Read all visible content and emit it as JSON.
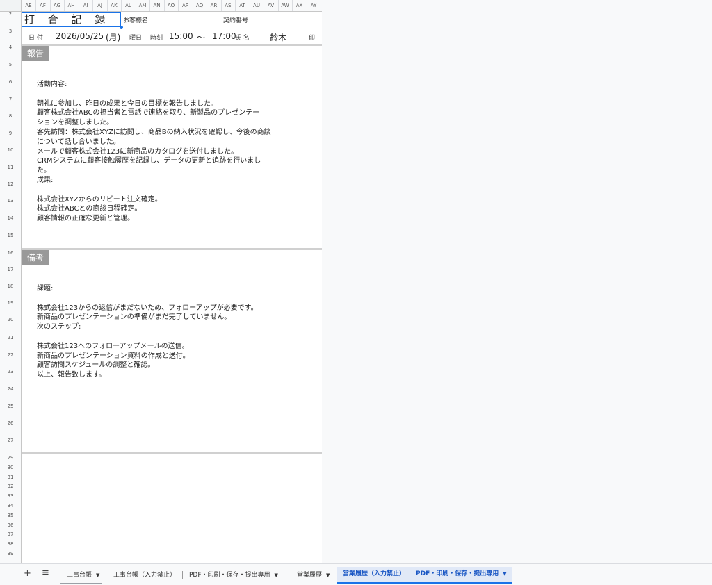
{
  "columns": [
    "AE",
    "AF",
    "AG",
    "AH",
    "AI",
    "AJ",
    "AK",
    "AL",
    "AM",
    "AN",
    "AO",
    "AP",
    "AQ",
    "AR",
    "AS",
    "AT",
    "AU",
    "AV",
    "AW",
    "AX",
    "AY"
  ],
  "rows_top": [
    "2",
    "3",
    "4",
    "5",
    "6",
    "7",
    "8",
    "9",
    "10",
    "11",
    "12",
    "13",
    "14",
    "15",
    "16",
    "17",
    "18",
    "19",
    "20",
    "21",
    "22",
    "23",
    "24",
    "25",
    "26",
    "27"
  ],
  "rows_bottom": [
    "29",
    "30",
    "31",
    "32",
    "33",
    "34",
    "35",
    "36",
    "37",
    "38",
    "39"
  ],
  "header": {
    "title": "打 合 記 録",
    "customer_label": "お客様名",
    "contract_label": "契約番号",
    "date_label": "日 付",
    "date_value": "2026/05/25",
    "weekday_value": "(月)",
    "weekday_label": "曜日",
    "time_label": "時刻",
    "time_start": "15:00",
    "time_sep": "〜",
    "time_end": "17:00",
    "name_label": "氏 名",
    "name_value": "鈴木",
    "seal_label": "印"
  },
  "report": {
    "heading": "報告",
    "lines": [
      "活動内容:",
      "",
      "朝礼に参加し、昨日の成果と今日の目標を報告しました。",
      "顧客株式会社ABCの担当者と電話で連絡を取り、新製品のプレゼンテー",
      "ションを調整しました。",
      "客先訪問：株式会社XYZに訪問し、商品Bの納入状況を確認し、今後の商談",
      "について話し合いました。",
      "メールで顧客株式会社123に新商品のカタログを送付しました。",
      "CRMシステムに顧客接触履歴を記録し、データの更新と追跡を行いまし",
      "た。",
      "成果:",
      "",
      "株式会社XYZからのリピート注文確定。",
      "株式会社ABCとの商談日程確定。",
      "顧客情報の正確な更新と管理。"
    ]
  },
  "notes": {
    "heading": "備考",
    "lines": [
      "課題:",
      "",
      "株式会社123からの返信がまだないため、フォローアップが必要です。",
      "新商品のプレゼンテーションの準備がまだ完了していません。",
      "次のステップ:",
      "",
      "株式会社123へのフォローアップメールの送信。",
      "新商品のプレゼンテーション資料の作成と送付。",
      "顧客訪問スケジュールの調整と確認。",
      "以上、報告致します。"
    ]
  },
  "tabs": {
    "add": "+",
    "menu": "≡",
    "t1": "工事台帳",
    "t2": "工事台帳（入力禁止）",
    "t3": "PDF・印刷・保存・提出専用",
    "t4": "営業履歴",
    "t5": "営業履歴（入力禁止）",
    "t6": "PDF・印刷・保存・提出専用"
  },
  "colors": {
    "accent": "#1a73e8",
    "section_bg": "#999999"
  }
}
